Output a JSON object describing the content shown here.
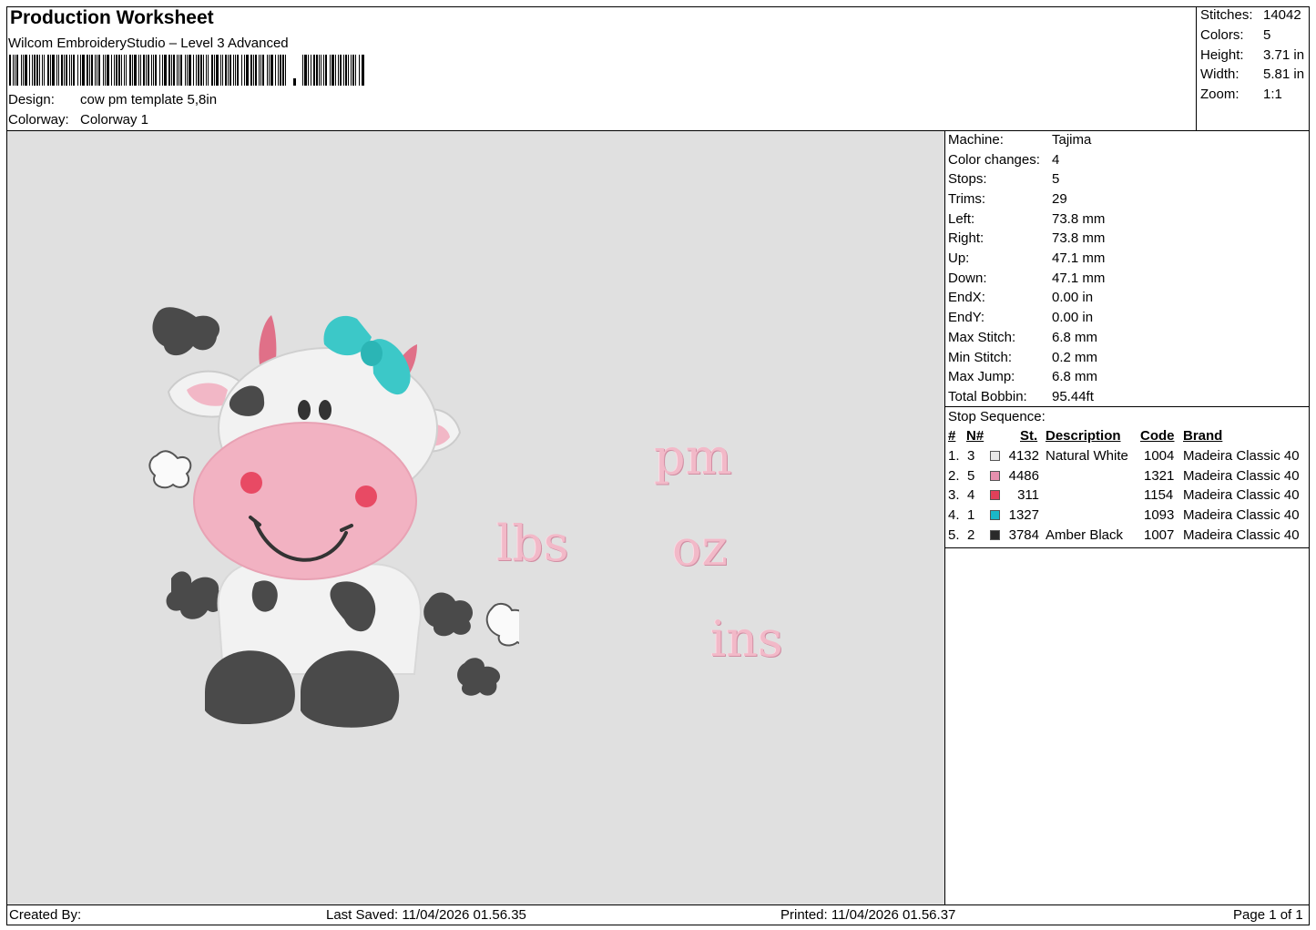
{
  "header": {
    "title": "Production Worksheet",
    "subtitle": "Wilcom EmbroideryStudio – Level 3 Advanced",
    "design_label": "Design:",
    "design_value": "cow pm template 5,8in",
    "colorway_label": "Colorway:",
    "colorway_value": "Colorway 1"
  },
  "stats": [
    {
      "label": "Stitches:",
      "value": "14042"
    },
    {
      "label": "Colors:",
      "value": "5"
    },
    {
      "label": "Height:",
      "value": "3.71 in"
    },
    {
      "label": "Width:",
      "value": "5.81 in"
    },
    {
      "label": "Zoom:",
      "value": "1:1"
    }
  ],
  "machine_info": [
    {
      "label": "Machine:",
      "value": "Tajima"
    },
    {
      "label": "Color changes:",
      "value": "4"
    },
    {
      "label": "Stops:",
      "value": "5"
    },
    {
      "label": "Trims:",
      "value": "29"
    },
    {
      "label": "Left:",
      "value": "73.8 mm"
    },
    {
      "label": "Right:",
      "value": "73.8 mm"
    },
    {
      "label": "Up:",
      "value": "47.1 mm"
    },
    {
      "label": "Down:",
      "value": "47.1 mm"
    },
    {
      "label": "EndX:",
      "value": "0.00 in"
    },
    {
      "label": "EndY:",
      "value": "0.00 in"
    },
    {
      "label": "Max Stitch:",
      "value": "6.8 mm"
    },
    {
      "label": "Min Stitch:",
      "value": "0.2 mm"
    },
    {
      "label": "Max Jump:",
      "value": "6.8 mm"
    },
    {
      "label": "Total Bobbin:",
      "value": "95.44ft"
    }
  ],
  "stop_sequence": {
    "title": "Stop Sequence:",
    "headers": [
      "#",
      "N#",
      "St.",
      "Description",
      "Code",
      "Brand"
    ],
    "rows": [
      {
        "num": "1.",
        "n": "3",
        "color": "#e8e8e8",
        "st": "4132",
        "desc": "Natural White",
        "code": "1004",
        "brand": "Madeira Classic 40"
      },
      {
        "num": "2.",
        "n": "5",
        "color": "#e690ae",
        "st": "4486",
        "desc": "",
        "code": "1321",
        "brand": "Madeira Classic 40"
      },
      {
        "num": "3.",
        "n": "4",
        "color": "#e0405a",
        "st": "311",
        "desc": "",
        "code": "1154",
        "brand": "Madeira Classic 40"
      },
      {
        "num": "4.",
        "n": "1",
        "color": "#1ab8c8",
        "st": "1327",
        "desc": "",
        "code": "1093",
        "brand": "Madeira Classic 40"
      },
      {
        "num": "5.",
        "n": "2",
        "color": "#2a2a2a",
        "st": "3784",
        "desc": "Amber Black",
        "code": "1007",
        "brand": "Madeira Classic 40"
      }
    ]
  },
  "design_text": {
    "lbs": "lbs",
    "pm": "pm",
    "oz": "oz",
    "ins": "ins"
  },
  "footer": {
    "created_by": "Created By:",
    "last_saved": "Last Saved: 11/04/2026 01.56.35",
    "printed": "Printed: 11/04/2026 01.56.37",
    "page": "Page 1 of 1"
  }
}
